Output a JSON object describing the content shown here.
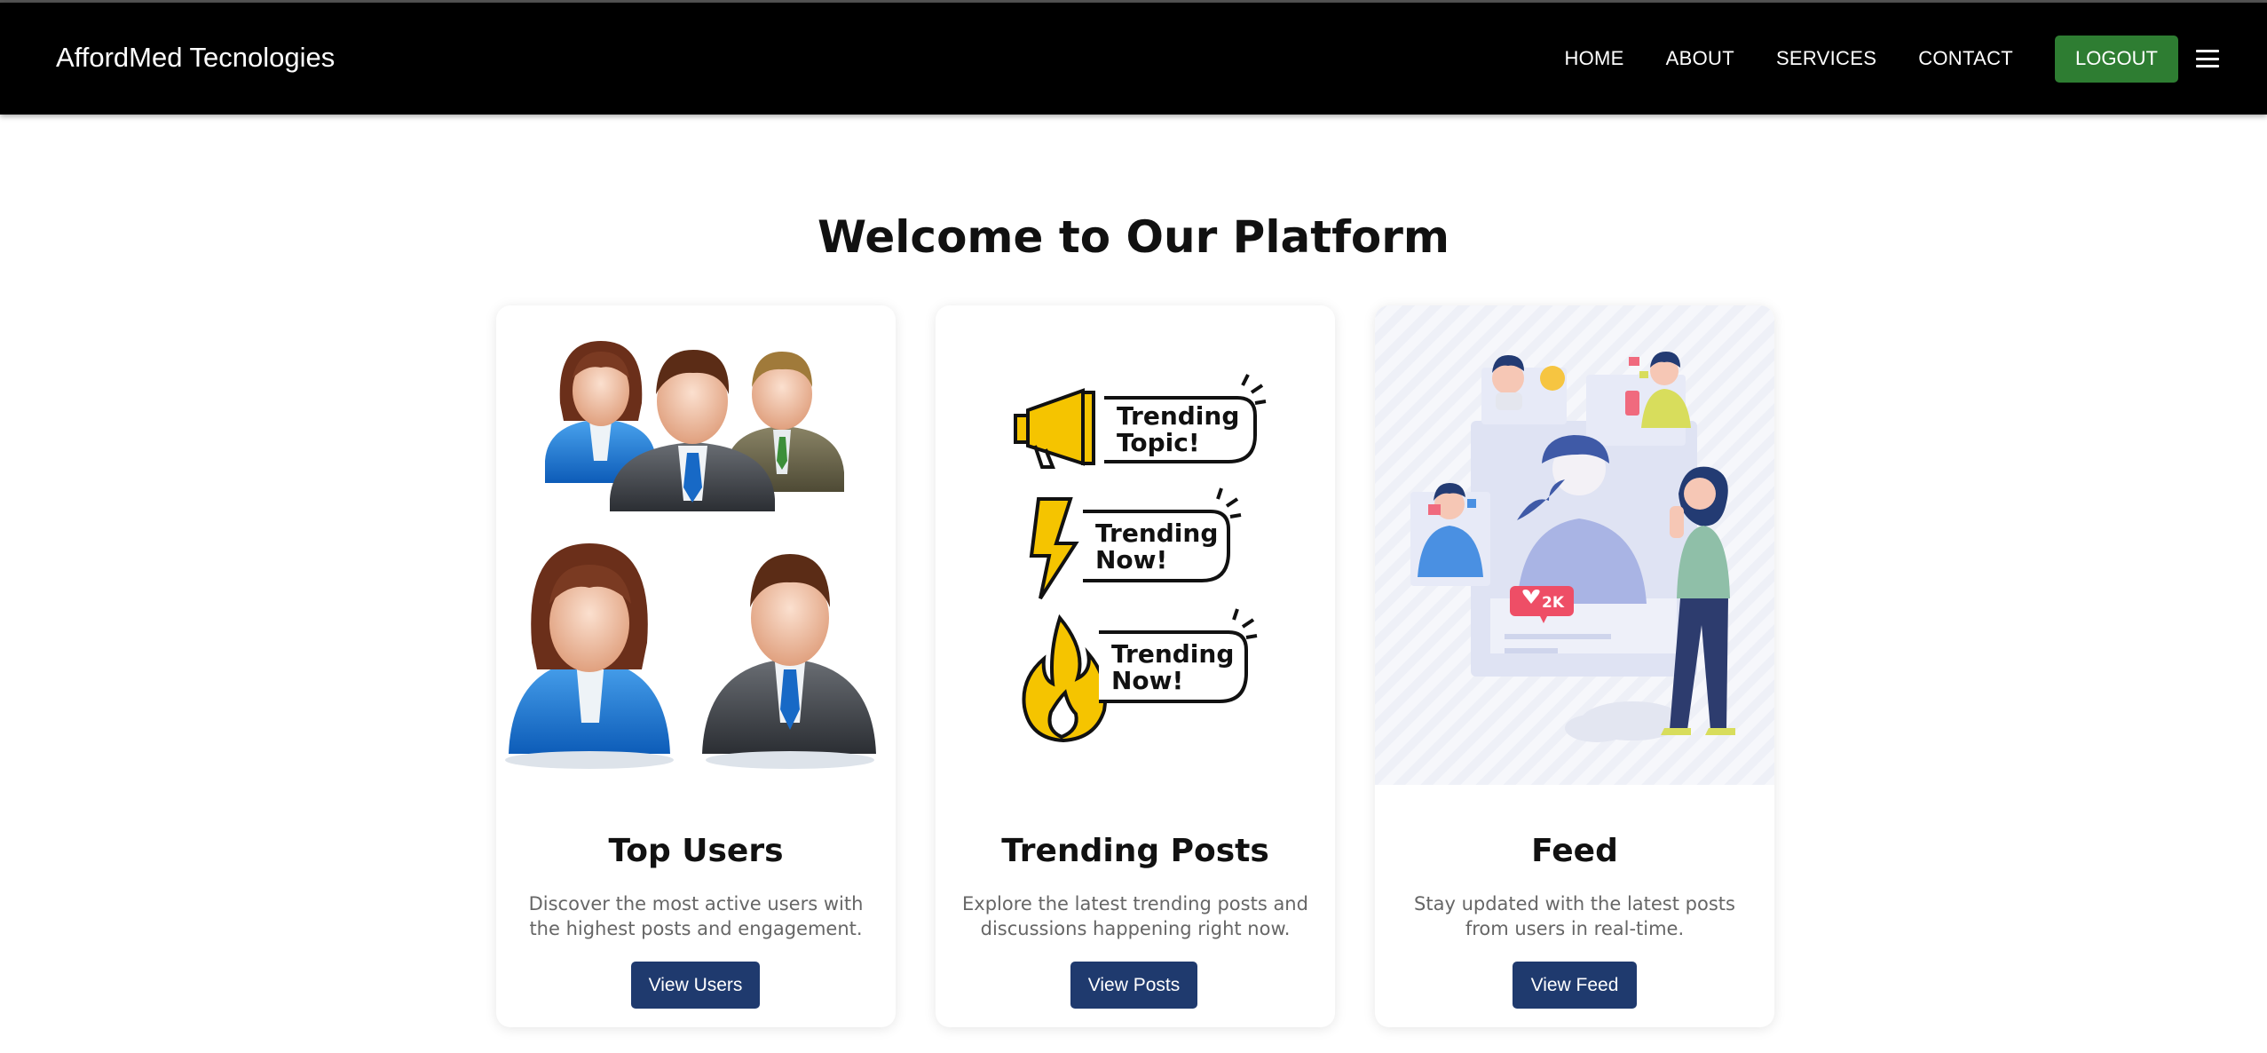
{
  "header": {
    "brand": "AffordMed Tecnologies",
    "nav": [
      "HOME",
      "ABOUT",
      "SERVICES",
      "CONTACT"
    ],
    "logout_label": "LOGOUT",
    "menu_icon": "hamburger-menu-icon"
  },
  "hero": {
    "title": "Welcome to Our Platform"
  },
  "cards": [
    {
      "title": "Top Users",
      "description": "Discover the most active users with the highest posts and engagement.",
      "button": "View Users",
      "image": "business-people-illustration"
    },
    {
      "title": "Trending Posts",
      "description": "Explore the latest trending posts and discussions happening right now.",
      "button": "View Posts",
      "image": "trending-badges-illustration",
      "badges": [
        {
          "line1": "Trending",
          "line2": "Topic!"
        },
        {
          "line1": "Trending",
          "line2": "Now!"
        },
        {
          "line1": "Trending",
          "line2": "Now!"
        }
      ]
    },
    {
      "title": "Feed",
      "description": "Stay updated with the latest posts from users in real-time.",
      "button": "View Feed",
      "image": "social-feed-illustration",
      "like_count": "2K"
    }
  ],
  "colors": {
    "navbar": "#000000",
    "logout": "#2e7d32",
    "card_button": "#1f3a6e",
    "badge_yellow": "#f5c400"
  }
}
